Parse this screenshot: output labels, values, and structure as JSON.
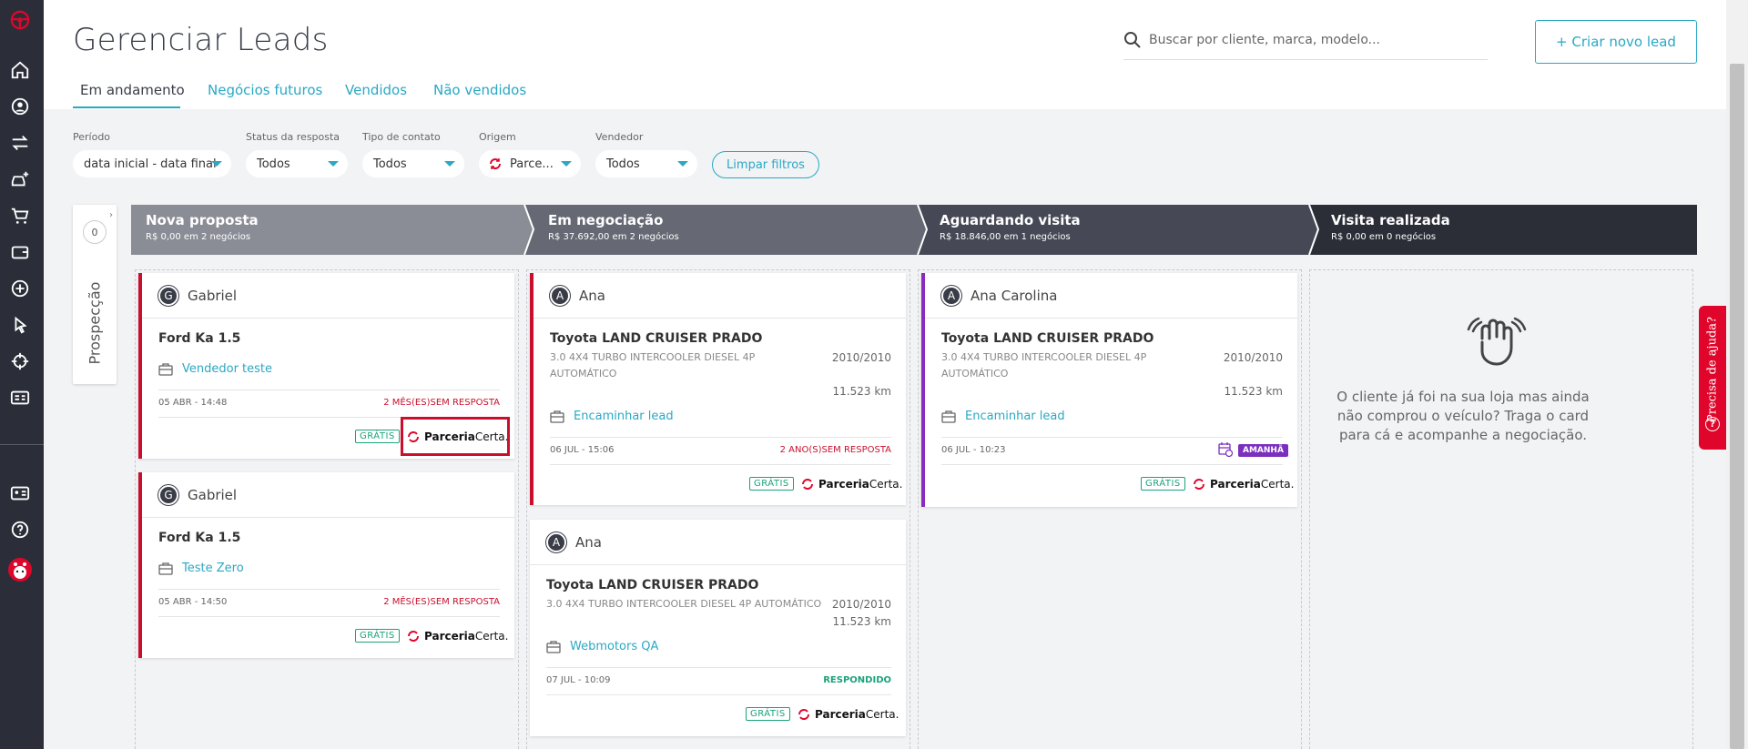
{
  "header": {
    "title": "Gerenciar Leads",
    "tabs": [
      {
        "label": "Em andamento",
        "active": true
      },
      {
        "label": "Negócios futuros",
        "active": false
      },
      {
        "label": "Vendidos",
        "active": false
      },
      {
        "label": "Não vendidos",
        "active": false
      }
    ],
    "search_placeholder": "Buscar por cliente, marca, modelo...",
    "new_lead_label": "+ Criar novo lead"
  },
  "filters": {
    "period": {
      "label": "Período",
      "value": "data inicial - data final"
    },
    "response_status": {
      "label": "Status da resposta",
      "value": "Todos"
    },
    "contact_type": {
      "label": "Tipo de contato",
      "value": "Todos"
    },
    "origin": {
      "label": "Origem",
      "value": "Parce..."
    },
    "seller": {
      "label": "Vendedor",
      "value": "Todos"
    },
    "clear_label": "Limpar filtros"
  },
  "prospect": {
    "label": "Prospecção",
    "count": "0"
  },
  "columns": [
    {
      "title": "Nova proposta",
      "summary": "R$ 0,00 em 2 negócios",
      "color": "#8b8d96"
    },
    {
      "title": "Em negociação",
      "summary": "R$ 37.692,00 em 2 negócios",
      "color": "#666974"
    },
    {
      "title": "Aguardando visita",
      "summary": "R$ 18.846,00 em 1 negócios",
      "color": "#464955"
    },
    {
      "title": "Visita realizada",
      "summary": "R$ 0,00 em 0 negócios",
      "color": "#2b2d37"
    }
  ],
  "cards": {
    "c1": {
      "initial": "G",
      "name": "Gabriel",
      "vehicle": "Ford Ka 1.5",
      "action": "Vendedor teste",
      "date": "05 ABR - 14:48",
      "status": "2 MÊS(ES)SEM RESPOSTA",
      "free": "GRÁTIS",
      "partner_bold": "Parceria",
      "partner_rest": "Certa."
    },
    "c2": {
      "initial": "G",
      "name": "Gabriel",
      "vehicle": "Ford Ka 1.5",
      "action": "Teste Zero",
      "date": "05 ABR - 14:50",
      "status": "2 MÊS(ES)SEM RESPOSTA",
      "free": "GRÁTIS",
      "partner_bold": "Parceria",
      "partner_rest": "Certa."
    },
    "c3": {
      "initial": "A",
      "name": "Ana",
      "vehicle": "Toyota LAND CRUISER PRADO",
      "version_l1": "3.0 4X4 TURBO INTERCOOLER DIESEL 4P",
      "version_l2": "AUTOMÁTICO",
      "year": "2010/2010",
      "km": "11.523 km",
      "action": "Encaminhar lead",
      "date": "06 JUL - 15:06",
      "status": "2 ANO(S)SEM RESPOSTA",
      "free": "GRÁTIS",
      "partner_bold": "Parceria",
      "partner_rest": "Certa."
    },
    "c4": {
      "initial": "A",
      "name": "Ana",
      "vehicle": "Toyota LAND CRUISER PRADO",
      "version_l1": "3.0 4X4 TURBO INTERCOOLER DIESEL 4P AUTOMÁTICO",
      "year": "2010/2010",
      "km": "11.523 km",
      "action": "Webmotors QA",
      "date": "07 JUL - 10:09",
      "status": "RESPONDIDO",
      "free": "GRÁTIS",
      "partner_bold": "Parceria",
      "partner_rest": "Certa."
    },
    "c5": {
      "initial": "A",
      "name": "Ana Carolina",
      "vehicle": "Toyota LAND CRUISER PRADO",
      "version_l1": "3.0 4X4 TURBO INTERCOOLER DIESEL 4P",
      "version_l2": "AUTOMÁTICO",
      "year": "2010/2010",
      "km": "11.523 km",
      "action": "Encaminhar lead",
      "date": "06 JUL - 10:23",
      "badge": "AMANHÃ",
      "free": "GRÁTIS",
      "partner_bold": "Parceria",
      "partner_rest": "Certa."
    }
  },
  "empty_state": "O cliente já foi na sua loja mas ainda não comprou o veículo? Traga o card para cá e acompanhe a negociação.",
  "help": {
    "label": "Precisa de ajuda?"
  },
  "colors": {
    "accent": "#2aa8c4",
    "danger": "#c8102e",
    "success": "#1aa37a",
    "purple": "#7b2fbf",
    "sidebar": "#2b2e38"
  }
}
